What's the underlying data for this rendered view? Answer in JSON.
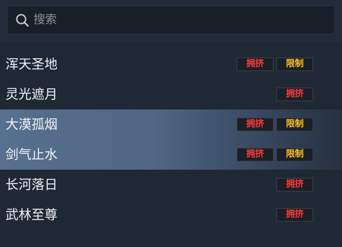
{
  "search": {
    "placeholder": "搜索",
    "icon": "search-icon"
  },
  "colors": {
    "crowded": "#ff3b3b",
    "limit": "#ffc21a",
    "background": "#1f2835"
  },
  "servers": [
    {
      "name": "浑天圣地",
      "tags": [
        "拥挤",
        "限制"
      ],
      "selected": false
    },
    {
      "name": "灵光遮月",
      "tags": [
        "拥挤"
      ],
      "selected": false
    },
    {
      "name": "大漠孤烟",
      "tags": [
        "拥挤",
        "限制"
      ],
      "selected": true
    },
    {
      "name": "剑气止水",
      "tags": [
        "拥挤",
        "限制"
      ],
      "selected": true
    },
    {
      "name": "长河落日",
      "tags": [
        "拥挤"
      ],
      "selected": false
    },
    {
      "name": "武林至尊",
      "tags": [
        "拥挤"
      ],
      "selected": false
    }
  ]
}
